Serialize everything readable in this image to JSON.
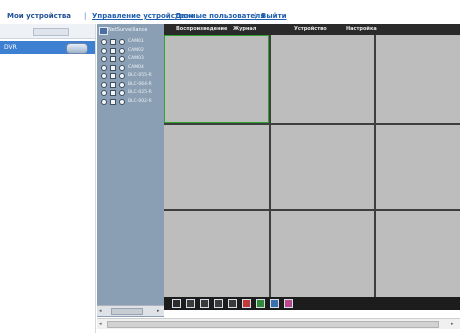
{
  "nav": {
    "items": [
      {
        "label": "Мои устройства"
      },
      {
        "label": "Управление устройством"
      },
      {
        "label": "Данные пользователя"
      },
      {
        "label": "Выйти"
      }
    ],
    "separator": "|"
  },
  "sidebar": {
    "row_label": "DVR"
  },
  "tree": {
    "root_label": "NetSurveillance",
    "items": [
      {
        "label": "CAM01"
      },
      {
        "label": "CAM02"
      },
      {
        "label": "CAM03"
      },
      {
        "label": "CAM04"
      },
      {
        "label": "BLC-055-R"
      },
      {
        "label": "BLC-064-R"
      },
      {
        "label": "BLC-025-R"
      },
      {
        "label": "BLC-002-R"
      }
    ],
    "scroll_left": "◂",
    "scroll_right": "▸"
  },
  "tabs": [
    {
      "label": "Воспроизведение"
    },
    {
      "label": "Журнал"
    },
    {
      "label": "Устройство"
    },
    {
      "label": "Настройка"
    }
  ],
  "grid": {
    "layout": "3x3",
    "selected_cell": 1,
    "selected_color": "#2ea32e"
  },
  "toolbar": {
    "icons": [
      {
        "name": "close-icon",
        "color": "#2b2b2b"
      },
      {
        "name": "single-view-icon",
        "color": "#3b3b3b"
      },
      {
        "name": "quad-view-icon",
        "color": "#3b3b3b"
      },
      {
        "name": "nine-view-icon",
        "color": "#3b3b3b"
      },
      {
        "name": "sixteen-view-icon",
        "color": "#3b3b3b"
      },
      {
        "name": "record-icon",
        "color": "#c23a3a"
      },
      {
        "name": "color-settings-icon",
        "color": "#2f8a3a"
      },
      {
        "name": "ptz-icon",
        "color": "#3a6fb0"
      },
      {
        "name": "snapshot-icon",
        "color": "#b84a8a"
      }
    ]
  },
  "scrollbar": {
    "left_arrow": "◂",
    "right_arrow": "▸"
  }
}
